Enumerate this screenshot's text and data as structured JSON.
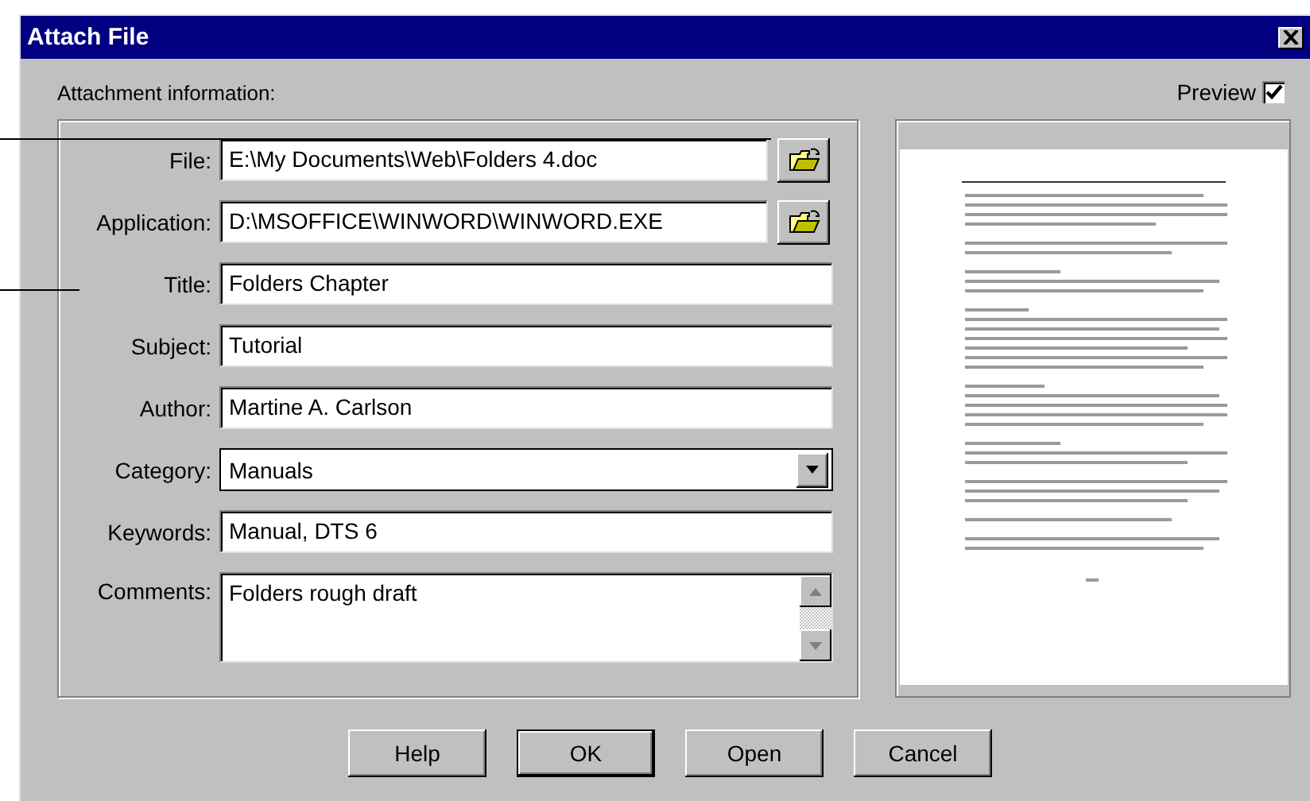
{
  "window": {
    "title": "Attach File"
  },
  "group": {
    "label": "Attachment information:"
  },
  "preview": {
    "label": "Preview",
    "checked": true
  },
  "fields": [
    {
      "kind": "browse",
      "label": "File:",
      "value": "E:\\My Documents\\Web\\Folders 4.doc"
    },
    {
      "kind": "browse",
      "label": "Application:",
      "value": "D:\\MSOFFICE\\WINWORD\\WINWORD.EXE"
    },
    {
      "kind": "text",
      "label": "Title:",
      "value": "Folders Chapter"
    },
    {
      "kind": "text",
      "label": "Subject:",
      "value": "Tutorial"
    },
    {
      "kind": "text",
      "label": "Author:",
      "value": "Martine A. Carlson"
    },
    {
      "kind": "dropdown",
      "label": "Category:",
      "value": "Manuals"
    },
    {
      "kind": "text",
      "label": "Keywords:",
      "value": "Manual, DTS 6"
    },
    {
      "kind": "memo",
      "label": "Comments:",
      "value": "Folders rough draft"
    }
  ],
  "buttons": [
    {
      "label": "Help",
      "default": false
    },
    {
      "label": "OK",
      "default": true
    },
    {
      "label": "Open",
      "default": false
    },
    {
      "label": "Cancel",
      "default": false
    }
  ]
}
